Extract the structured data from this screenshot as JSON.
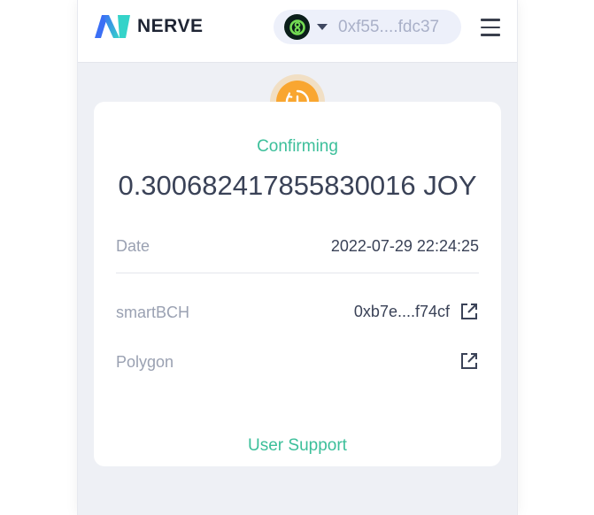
{
  "header": {
    "brand": "NERVE",
    "account": {
      "address": "0xf55....fdc37"
    }
  },
  "transaction": {
    "status": "Confirming",
    "amount": "0.300682417855830016 JOY",
    "date_label": "Date",
    "date_value": "2022-07-29 22:24:25",
    "from_chain_label": "smartBCH",
    "from_hash": "0xb7e....f74cf",
    "to_chain_label": "Polygon",
    "to_hash": ""
  },
  "footer": {
    "support_label": "User Support"
  },
  "colors": {
    "accent_green": "#3cbf9a",
    "status_orange": "#f9a630",
    "text_dark": "#3a4257",
    "text_muted": "#9aa1b2",
    "background": "#eef0f5"
  },
  "icons": {
    "logo": "nerve-logo-icon",
    "chain": "smartbch-logo-icon",
    "dropdown": "caret-down-icon",
    "menu": "hamburger-menu-icon",
    "status": "clock-icon",
    "external_link": "external-link-icon"
  }
}
